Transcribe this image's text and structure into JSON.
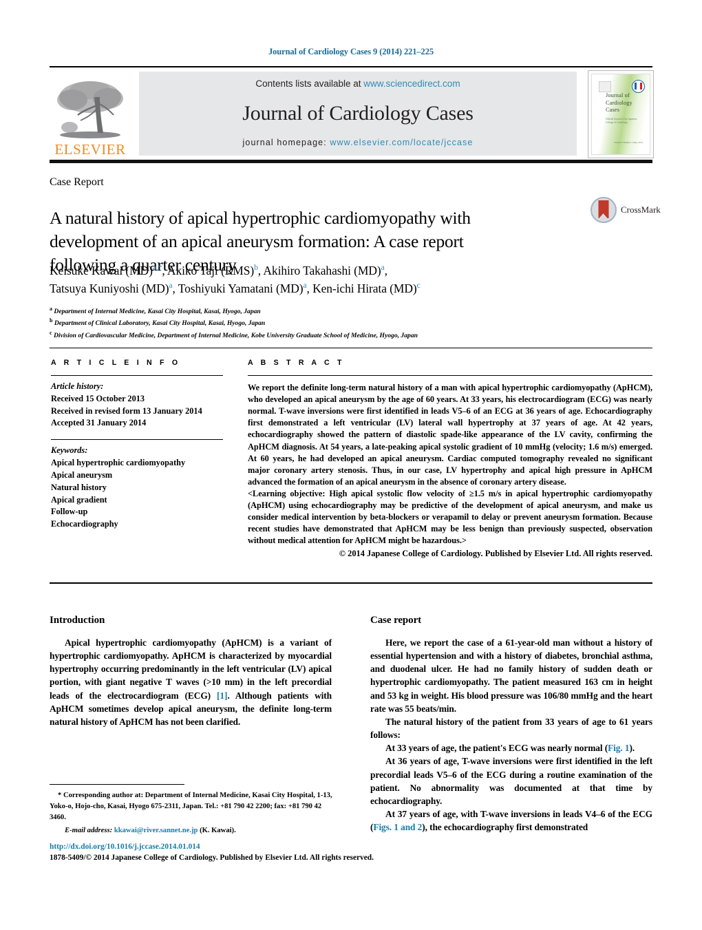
{
  "running_head": "Journal of Cardiology Cases 9 (2014) 221–225",
  "masthead": {
    "contents_prefix": "Contents lists available at ",
    "contents_link": "www.sciencedirect.com",
    "journal_name": "Journal of Cardiology Cases",
    "homepage_prefix": "journal homepage: ",
    "homepage_link": "www.elsevier.com/locate/jccase",
    "publisher_logo_text": "ELSEVIER",
    "cover": {
      "line1": "Journal of",
      "line2": "Cardiology",
      "line3": "Cases",
      "subtitle": "Official Journal of the Japanese College of Cardiology",
      "footer": "Volume 9 Number 5\nMay 2014"
    }
  },
  "article": {
    "type": "Case Report",
    "title": "A natural history of apical hypertrophic cardiomyopathy with development of an apical aneurysm formation: A case report following a quarter century",
    "authors_line1": "Keisuke Kawai (MD)|a,*|, Akiko Taji (RMS)|b|, Akihiro Takahashi (MD)|a|,",
    "authors_line2": "Tatsuya Kuniyoshi (MD)|a|, Toshiyuki Yamatani (MD)|a|, Ken-ichi Hirata (MD)|c|",
    "authors": [
      {
        "name": "Keisuke Kawai (MD)",
        "marks": "a,*"
      },
      {
        "name": "Akiko Taji (RMS)",
        "marks": "b"
      },
      {
        "name": "Akihiro Takahashi (MD)",
        "marks": "a"
      },
      {
        "name": "Tatsuya Kuniyoshi (MD)",
        "marks": "a"
      },
      {
        "name": "Toshiyuki Yamatani (MD)",
        "marks": "a"
      },
      {
        "name": "Ken-ichi Hirata (MD)",
        "marks": "c"
      }
    ],
    "affiliations": [
      {
        "mark": "a",
        "text": "Department of Internal Medicine, Kasai City Hospital, Kasai, Hyogo, Japan"
      },
      {
        "mark": "b",
        "text": "Department of Clinical Laboratory, Kasai City Hospital, Kasai, Hyogo, Japan"
      },
      {
        "mark": "c",
        "text": "Division of Cardiovascular Medicine, Department of Internal Medicine, Kobe University Graduate School of Medicine, Hyogo, Japan"
      }
    ],
    "crossmark_label": "CrossMark"
  },
  "article_info": {
    "heading": "A R T I C L E  I N F O",
    "history_label": "Article history:",
    "history": [
      "Received 15 October 2013",
      "Received in revised form 13 January 2014",
      "Accepted 31 January 2014"
    ],
    "keywords_label": "Keywords:",
    "keywords": [
      "Apical hypertrophic cardiomyopathy",
      "Apical aneurysm",
      "Natural history",
      "Apical gradient",
      "Follow-up",
      "Echocardiography"
    ]
  },
  "abstract": {
    "heading": "A B S T R A C T",
    "body": "We report the definite long-term natural history of a man with apical hypertrophic cardiomyopathy (ApHCM), who developed an apical aneurysm by the age of 60 years. At 33 years, his electrocardiogram (ECG) was nearly normal. T-wave inversions were first identified in leads V5–6 of an ECG at 36 years of age. Echocardiography first demonstrated a left ventricular (LV) lateral wall hypertrophy at 37 years of age. At 42 years, echocardiography showed the pattern of diastolic spade-like appearance of the LV cavity, confirming the ApHCM diagnosis. At 54 years, a late-peaking apical systolic gradient of 10 mmHg (velocity; 1.6 m/s) emerged. At 60 years, he had developed an apical aneurysm. Cardiac computed tomography revealed no significant major coronary artery stenosis. Thus, in our case, LV hypertrophy and apical high pressure in ApHCM advanced the formation of an apical aneurysm in the absence of coronary artery disease.",
    "learning_objective_label": "<Learning objective:",
    "learning_objective": "High apical systolic flow velocity of ≥1.5 m/s in apical hypertrophic cardiomyopathy (ApHCM) using echocardiography may be predictive of the development of apical aneurysm, and make us consider medical intervention by beta-blockers or verapamil to delay or prevent aneurysm formation. Because recent studies have demonstrated that ApHCM may be less benign than previously suspected, observation without medical attention for ApHCM might be hazardous.>",
    "copyright": "© 2014 Japanese College of Cardiology. Published by Elsevier Ltd. All rights reserved."
  },
  "sections": {
    "introduction": {
      "heading": "Introduction",
      "paragraph_pre": "Apical hypertrophic cardiomyopathy (ApHCM) is a variant of hypertrophic cardiomyopathy. ApHCM is characterized by myocardial hypertrophy occurring predominantly in the left ventricular (LV) apical portion, with giant negative T waves (>10 mm) in the left precordial leads of the electrocardiogram (ECG) ",
      "ref": "[1]",
      "paragraph_post": ". Although patients with ApHCM sometimes develop apical aneurysm, the definite long-term natural history of ApHCM has not been clarified."
    },
    "case_report": {
      "heading": "Case report",
      "p1": "Here, we report the case of a 61-year-old man without a history of essential hypertension and with a history of diabetes, bronchial asthma, and duodenal ulcer. He had no family history of sudden death or hypertrophic cardiomyopathy. The patient measured 163 cm in height and 53 kg in weight. His blood pressure was 106/80 mmHg and the heart rate was 55 beats/min.",
      "p2": "The natural history of the patient from 33 years of age to 61 years follows:",
      "p3_pre": "At 33 years of age, the patient's ECG was nearly normal (",
      "p3_link": "Fig. 1",
      "p3_post": ").",
      "p4": "At 36 years of age, T-wave inversions were first identified in the left precordial leads V5–6 of the ECG during a routine examination of the patient. No abnormality was documented at that time by echocardiography.",
      "p5_pre": "At 37 years of age, with T-wave inversions in leads V4–6 of the ECG (",
      "p5_link": "Figs. 1 and 2",
      "p5_post": "), the echocardiography first demonstrated"
    }
  },
  "footnote": {
    "corresponding": "* Corresponding author at: Department of Internal Medicine, Kasai City Hospital, 1-13, Yoko-o, Hojo-cho, Kasai, Hyogo 675-2311, Japan. Tel.: +81 790 42 2200; fax: +81 790 42 3460.",
    "email_label": "E-mail address:",
    "email": "kkawai@river.sannet.ne.jp",
    "email_suffix": "(K. Kawai)."
  },
  "doi_block": {
    "doi": "http://dx.doi.org/10.1016/j.jccase.2014.01.014",
    "issn_line": "1878-5409/© 2014 Japanese College of Cardiology. Published by Elsevier Ltd. All rights reserved."
  },
  "colors": {
    "link": "#1a7ba8",
    "header_blue": "#1a6c96",
    "elsevier_orange": "#ec8c22",
    "band_gray": "#e6e7e8",
    "crossmark_red": "#c0392b"
  }
}
